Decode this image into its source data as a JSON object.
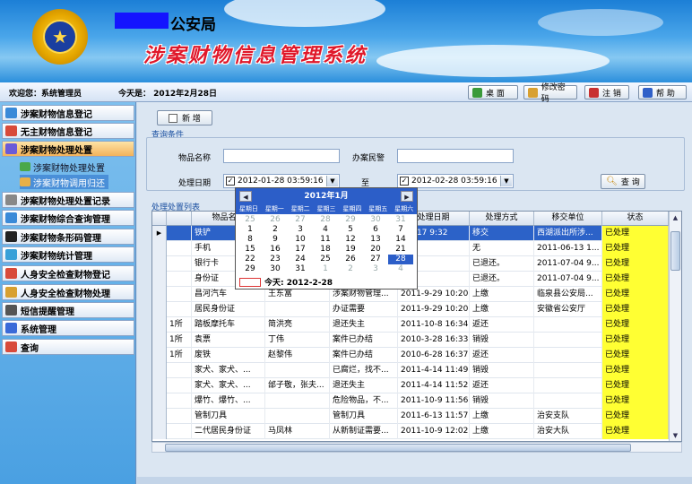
{
  "header": {
    "bureau_suffix": "公安局",
    "system_title": "涉案财物信息管理系统"
  },
  "statusbar": {
    "welcome": "欢迎您：系统管理员",
    "today": "今天是： 2012年2月28日",
    "buttons": [
      "桌 面",
      "修改密码",
      "注 销",
      "帮 助"
    ]
  },
  "sidebar": {
    "items": [
      "涉案财物信息登记",
      "无主财物信息登记",
      "涉案财物处理处置",
      "涉案财物处理处置记录",
      "涉案财物综合查询管理",
      "涉案财物条形码管理",
      "涉案财物统计管理",
      "人身安全检查财物登记",
      "人身安全检查财物处理",
      "短信提醒管理",
      "系统管理",
      "查询"
    ],
    "subitems": [
      "涉案财物处理处置",
      "涉案财物调用归还"
    ]
  },
  "toolbar": {
    "add_label": "新 增"
  },
  "query": {
    "group_label": "查询条件",
    "item_name_label": "物品名称",
    "officer_label": "办案民警",
    "date_label": "处理日期",
    "to_label": "至",
    "date_from": "2012-01-28 03:59:16",
    "date_to": "2012-02-28 03:59:16",
    "query_button": "查 询"
  },
  "list": {
    "group_label": "处理处置列表",
    "columns": [
      "",
      "物品名称",
      "",
      "",
      "处理日期",
      "处理方式",
      "移交单位",
      "状态"
    ],
    "rows": [
      [
        "",
        "铁铲",
        "",
        "",
        "1-9-17 9:32",
        "移交",
        "西湖派出所涉...",
        "已处理"
      ],
      [
        "",
        "手机",
        "",
        "",
        "",
        "无",
        "2011-06-13 1...",
        "已处理"
      ],
      [
        "",
        "银行卡",
        "",
        "",
        "",
        "已退还。",
        "2011-07-04 9...",
        "已处理"
      ],
      [
        "",
        "身份证",
        "",
        "",
        "",
        "已退还。",
        "2011-07-04 9...",
        "已处理"
      ],
      [
        "",
        "昌河汽车",
        "王东富",
        "涉案财物管理...",
        "2011-9-29 10:20",
        "上缴",
        "临泉县公安局...",
        "已处理"
      ],
      [
        "",
        "居民身份证",
        "",
        "办证需要",
        "2011-9-29 10:20",
        "上缴",
        "安徽省公安厅",
        "已处理"
      ],
      [
        "1所",
        "踏板摩托车",
        "简洪亮",
        "退还失主",
        "2011-10-8 16:34",
        "返还",
        "",
        "已处理"
      ],
      [
        "1所",
        "袁票",
        "丁伟",
        "案件已办结",
        "2010-3-28 16:33",
        "销毁",
        "",
        "已处理"
      ],
      [
        "1所",
        "废铁",
        "赵黎伟",
        "案件已办结",
        "2010-6-28 16:37",
        "返还",
        "",
        "已处理"
      ],
      [
        "",
        "家犬、家犬、...",
        "",
        "已腐烂，找不...",
        "2011-4-14 11:49",
        "销毁",
        "",
        "已处理"
      ],
      [
        "",
        "家犬、家犬、...",
        "邰子敬，张夫...",
        "退还失主",
        "2011-4-14 11:52",
        "返还",
        "",
        "已处理"
      ],
      [
        "",
        "爆竹、爆竹、...",
        "",
        "危险物品，不...",
        "2011-10-9 11:56",
        "销毁",
        "",
        "已处理"
      ],
      [
        "",
        "管制刀具",
        "",
        "管制刀具",
        "2011-6-13 11:57",
        "上缴",
        "治安支队",
        "已处理"
      ],
      [
        "",
        "二代居民身份证",
        "马凤林",
        "从新制证需要...",
        "2011-10-9 12:02",
        "上缴",
        "治安大队",
        "已处理"
      ]
    ]
  },
  "calendar": {
    "month_title": "2012年1月",
    "prev": "◀",
    "next": "▶",
    "weekdays": [
      "星期日",
      "星期一",
      "星期二",
      "星期三",
      "星期四",
      "星期五",
      "星期六"
    ],
    "days": [
      [
        "25",
        "26",
        "27",
        "28",
        "29",
        "30",
        "31"
      ],
      [
        "1",
        "2",
        "3",
        "4",
        "5",
        "6",
        "7"
      ],
      [
        "8",
        "9",
        "10",
        "11",
        "12",
        "13",
        "14"
      ],
      [
        "15",
        "16",
        "17",
        "18",
        "19",
        "20",
        "21"
      ],
      [
        "22",
        "23",
        "24",
        "25",
        "26",
        "27",
        "28"
      ],
      [
        "29",
        "30",
        "31",
        "1",
        "2",
        "3",
        "4"
      ]
    ],
    "today_label": "今天:  2012-2-28"
  }
}
